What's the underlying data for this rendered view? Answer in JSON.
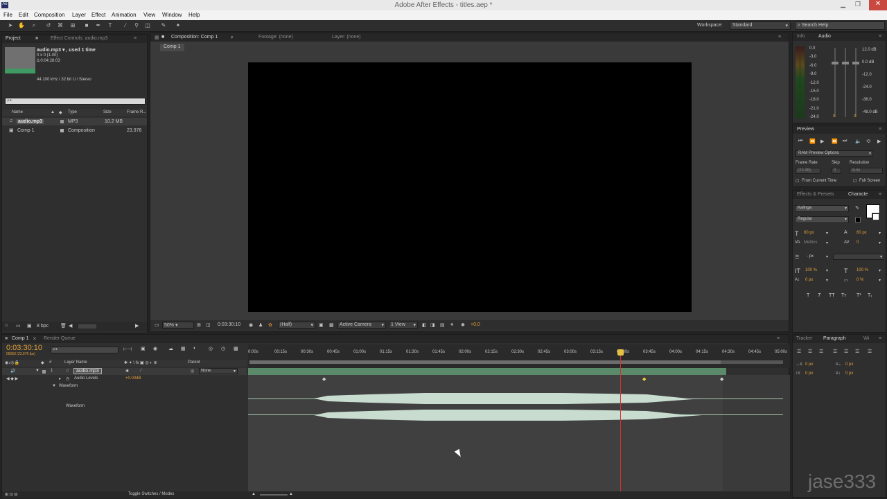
{
  "window": {
    "title": "Adobe After Effects - titles.aep *",
    "icon": "Ae"
  },
  "menu": [
    "File",
    "Edit",
    "Composition",
    "Layer",
    "Effect",
    "Animation",
    "View",
    "Window",
    "Help"
  ],
  "toolbar": {
    "workspace_label": "Workspace:",
    "workspace_value": "Standard",
    "search_placeholder": "Search Help"
  },
  "project": {
    "tab": "Project",
    "tab2": "Effect Controls: audio.mp3",
    "asset_name": "audio.mp3 ▾ , used 1 time",
    "asset_dims": "0 x 0 (1.00)",
    "asset_dur": "Δ 0:04:28:03",
    "asset_audio": "44.100 kHz / 32 bit U / Stereo",
    "cols": {
      "name": "Name",
      "type": "Type",
      "size": "Size",
      "frame": "Frame R..."
    },
    "items": [
      {
        "name": "audio.mp3",
        "type": "MP3",
        "size": "10.2 MB",
        "frame": ""
      },
      {
        "name": "Comp 1",
        "type": "Composition",
        "size": "",
        "frame": "23.976"
      }
    ],
    "bpc": "8 bpc"
  },
  "viewer": {
    "tabs": [
      "Composition: Comp 1",
      "Footage: (none)",
      "Layer: (none)"
    ],
    "comp_tab": "Comp 1",
    "zoom": "50%",
    "timecode": "0:03:30:10",
    "resolution": "(Half)",
    "camera": "Active Camera",
    "views": "1 View",
    "offset": "+0.0"
  },
  "info_panel": {
    "tabs": [
      "Info",
      "Audio"
    ],
    "db_left": [
      "0.0",
      "-3.0",
      "-6.0",
      "-9.0",
      "-12.0",
      "-15.0",
      "-18.0",
      "-21.0",
      "-24.0"
    ],
    "db_right": [
      "12.0 dB",
      "0.0 dB",
      "-12.0",
      "-24.0",
      "-36.0",
      "-48.0 dB"
    ],
    "level_left": "0",
    "level_right": "0"
  },
  "preview": {
    "tab": "Preview",
    "ram_options": "RAM Preview Options",
    "frame_rate_label": "Frame Rate",
    "skip_label": "Skip",
    "resolution_label": "Resolution",
    "frame_rate": "(23.98)",
    "skip": "0",
    "resolution": "Auto",
    "from_current": "From Current Time",
    "full_screen": "Full Screen"
  },
  "character": {
    "tabs": [
      "Effects & Presets",
      "Characte"
    ],
    "font": "Kalinga",
    "style": "Regular",
    "size": "60 px",
    "leading": "60 px",
    "kerning": "Metrics",
    "tracking": "0",
    "stroke": "- px",
    "vscale": "100 %",
    "hscale": "100 %",
    "baseline": "0 px",
    "tsume": "0 %"
  },
  "timeline": {
    "tabs": [
      "Comp 1",
      "Render Queue"
    ],
    "timecode": "0:03:30:10",
    "frames": "05050 (23.976 fps)",
    "ruler": [
      "0:00s",
      "00:15s",
      "00:30s",
      "00:45s",
      "01:00s",
      "01:15s",
      "01:30s",
      "01:45s",
      "02:00s",
      "02:15s",
      "02:30s",
      "02:45s",
      "03:00s",
      "03:15s",
      "03:30s",
      "03:45s",
      "04:00s",
      "04:15s",
      "04:30s",
      "04:45s",
      "05:00s"
    ],
    "col_layer": "Layer Name",
    "col_parent": "Parent",
    "layer_num": "1",
    "layer_name": "audio.mp3",
    "parent": "None",
    "prop_audio": "Audio Levels",
    "prop_audio_val": "+0.00dB",
    "prop_wave": "Waveform",
    "prop_wave2": "Waveform",
    "toggle": "Toggle Switches / Modes"
  },
  "paragraph": {
    "tabs": [
      "Tracker",
      "Paragraph",
      "Wi"
    ],
    "indent": [
      "0 px",
      "0 px",
      "0 px",
      "0 px"
    ]
  },
  "watermark": "jase333"
}
